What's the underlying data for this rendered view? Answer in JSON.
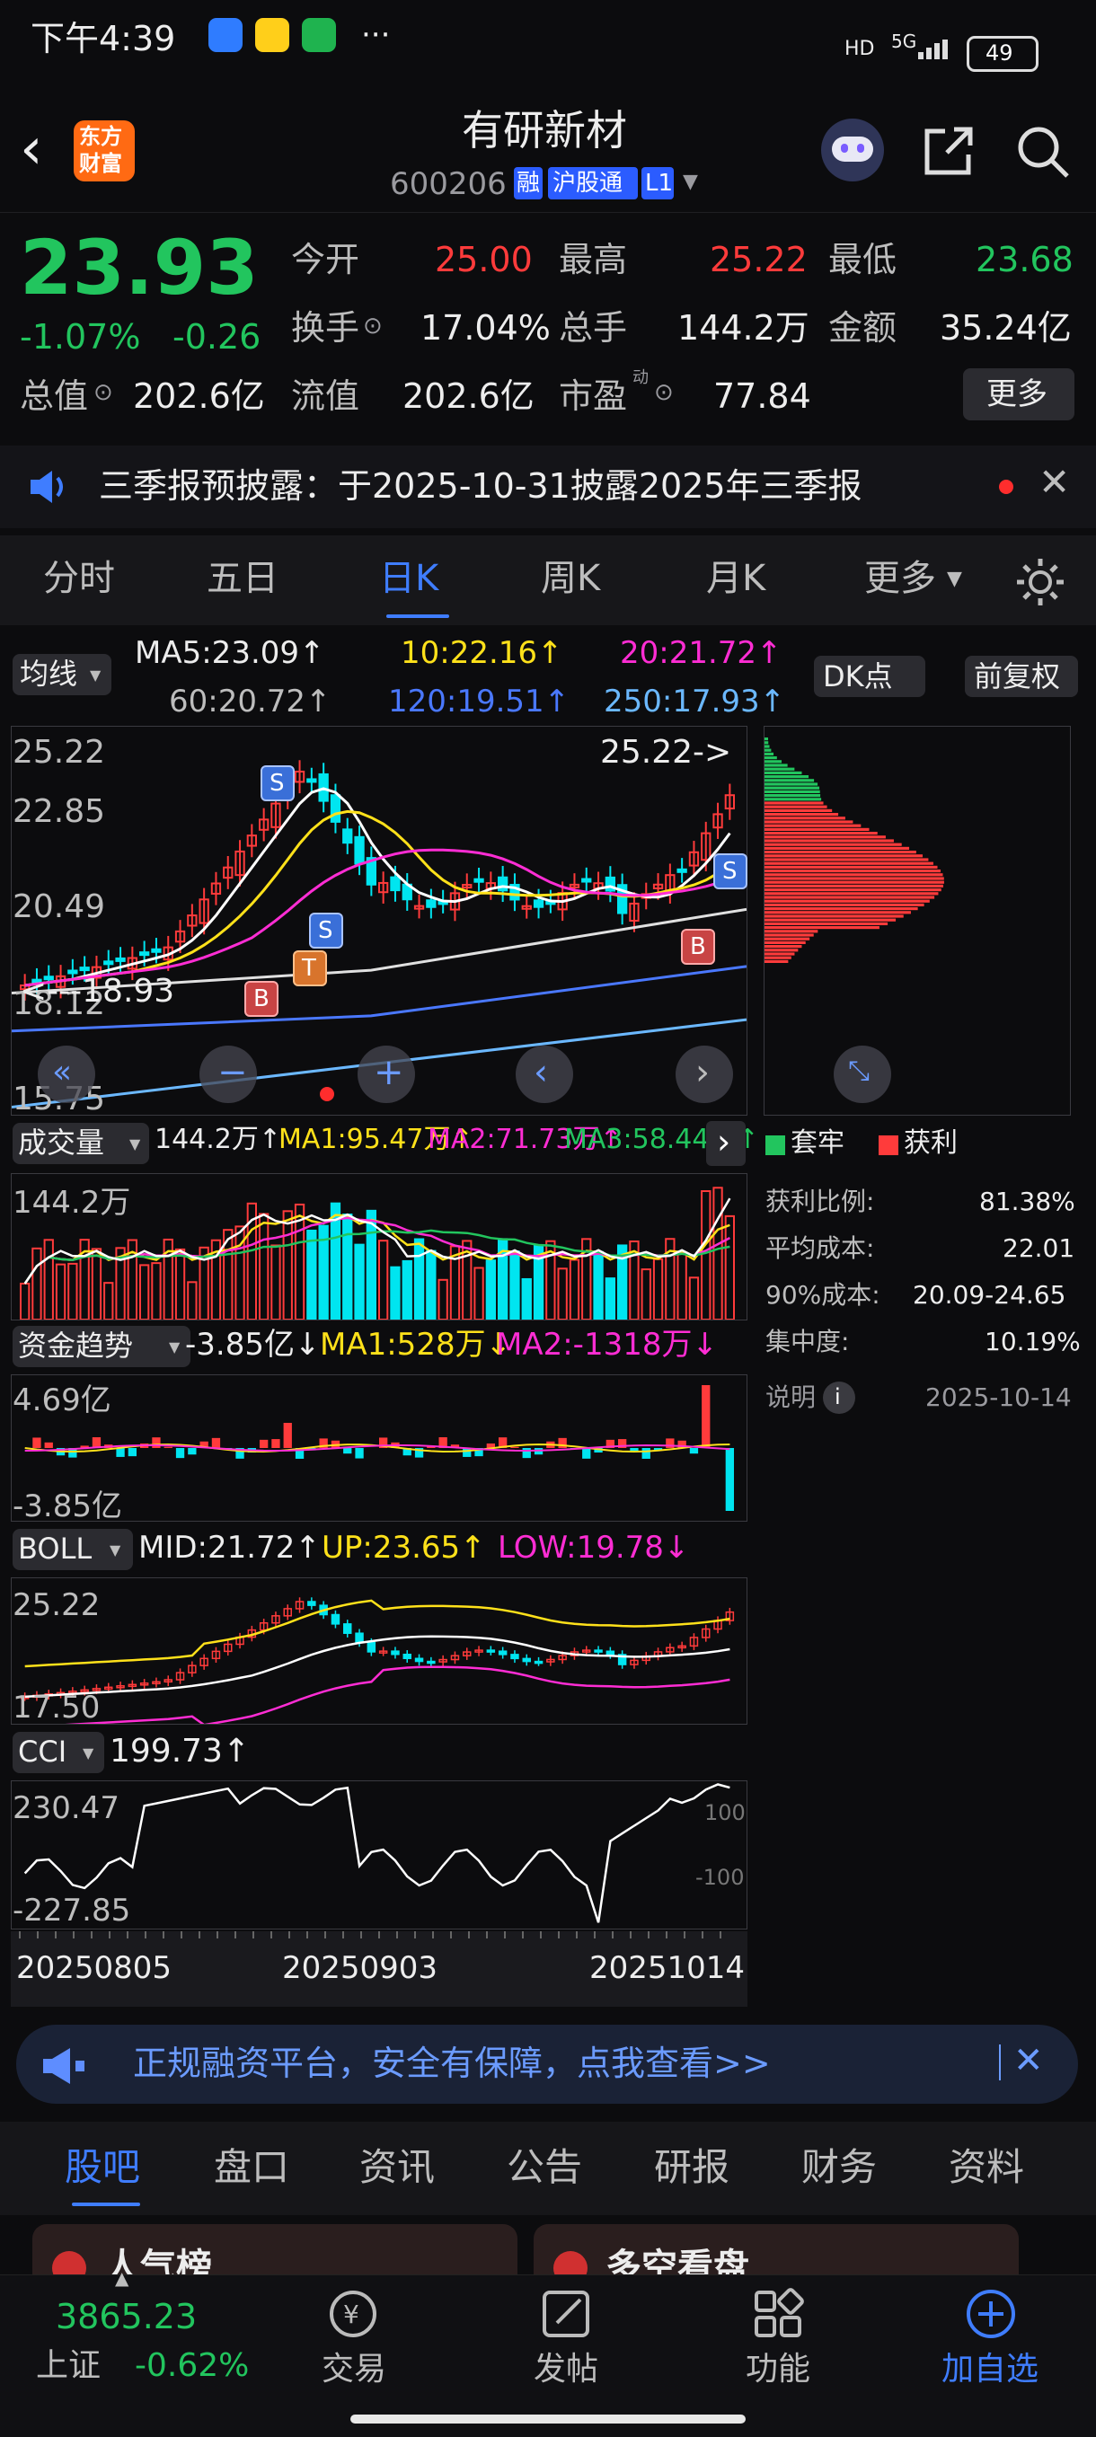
{
  "status_bar": {
    "time": "下午4:39",
    "battery": "49",
    "net": "5G"
  },
  "header": {
    "stock_name": "有研新材",
    "stock_code": "600206",
    "badges": [
      "融",
      "沪股通",
      "L1"
    ],
    "logo_text": [
      "东方",
      "财富"
    ]
  },
  "quote": {
    "price": "23.93",
    "change_pct": "-1.07%",
    "change": "-0.26",
    "open_label": "今开",
    "open": "25.00",
    "high_label": "最高",
    "high": "25.22",
    "low_label": "最低",
    "low": "23.68",
    "turnover_label": "换手",
    "turnover": "17.04%",
    "volume_label": "总手",
    "volume": "144.2万",
    "amount_label": "金额",
    "amount": "35.24亿",
    "mktcap_label": "总值",
    "mktcap": "202.6亿",
    "float_label": "流值",
    "float_cap": "202.6亿",
    "pe_label": "市盈",
    "pe_sup": "动",
    "pe": "77.84",
    "more_label": "更多"
  },
  "notice": {
    "text": "三季报预披露：于2025-10-31披露2025年三季报"
  },
  "period_tabs": {
    "items": [
      "分时",
      "五日",
      "日K",
      "周K",
      "月K",
      "更多"
    ],
    "active": "日K"
  },
  "kline": {
    "ma_select": "均线",
    "ma5": "MA5:23.09↑",
    "ma10": "10:22.16↑",
    "ma20": "20:21.72↑",
    "ma60": "60:20.72↑",
    "ma120": "120:19.51↑",
    "ma250": "250:17.93↑",
    "dk_label": "DK点",
    "adjust_label": "前复权",
    "y_labels": [
      "25.22",
      "22.85",
      "20.49",
      "18.12",
      "15.75"
    ],
    "high_marker": "25.22->",
    "low_marker": "<---18.93",
    "signals": [
      "S",
      "S",
      "T",
      "B",
      "B",
      "S"
    ]
  },
  "chips": {
    "legend_trapped": "套牢",
    "legend_profit": "获利",
    "rows": [
      {
        "label": "获利比例:",
        "value": "81.38%"
      },
      {
        "label": "平均成本:",
        "value": "22.01"
      },
      {
        "label": "90%成本:",
        "value": "20.09-24.65"
      },
      {
        "label": "集中度:",
        "value": "10.19%"
      }
    ],
    "note_label": "说明",
    "date": "2025-10-14"
  },
  "volume_panel": {
    "title": "成交量",
    "vol": "144.2万↑",
    "ma1": "MA1:95.47万↑",
    "ma2": "MA2:71.73万↑",
    "ma3": "MA3:58.44万↑",
    "y_label": "144.2万"
  },
  "fund_panel": {
    "title": "资金趋势",
    "value": "-3.85亿↓",
    "ma1": "MA1:528万↓",
    "ma2": "MA2:-1318万↓",
    "y_top": "4.69亿",
    "y_bottom": "-3.85亿"
  },
  "boll_panel": {
    "title": "BOLL",
    "mid": "MID:21.72↑",
    "up": "UP:23.65↑",
    "low": "LOW:19.78↓",
    "y_top": "25.22",
    "y_bottom": "17.50"
  },
  "cci_panel": {
    "title": "CCI",
    "value": "199.73↑",
    "y_top": "230.47",
    "y_bottom": "-227.85",
    "ref_top": "100",
    "ref_bottom": "-100"
  },
  "dates": [
    "20250805",
    "20250903",
    "20251014"
  ],
  "ad_banner": {
    "text": "正规融资平台，安全有保障，点我查看>>"
  },
  "bottom_tabs": {
    "items": [
      "股吧",
      "盘口",
      "资讯",
      "公告",
      "研报",
      "财务",
      "资料"
    ],
    "active": "股吧"
  },
  "cards": [
    "人气榜",
    "多空看盘"
  ],
  "dock": {
    "index_value": "3865.23",
    "index_name": "上证",
    "index_change": "-0.62%",
    "items": [
      "交易",
      "发帖",
      "功能",
      "加自选"
    ]
  },
  "colors": {
    "up": "#ff3b3b",
    "down": "#22c55e",
    "cyan": "#00e5f0",
    "accent": "#3f7dff"
  }
}
